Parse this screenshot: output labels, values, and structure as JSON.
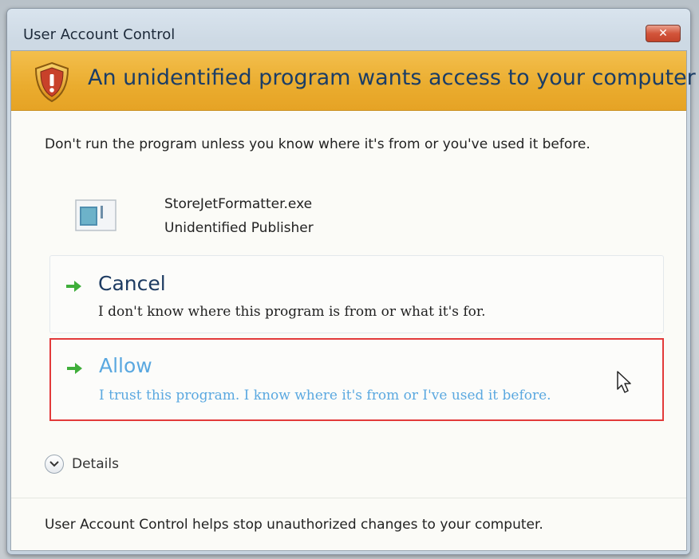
{
  "window": {
    "title": "User Account Control",
    "close_icon": "close-icon"
  },
  "banner": {
    "icon": "shield-warning-icon",
    "heading": "An unidentified program wants access to your computer",
    "color": "#eaac2e"
  },
  "warning": {
    "text": "Don't run the program unless you know where it's from or you've used it before."
  },
  "program": {
    "icon": "program-icon",
    "name": "StoreJetFormatter.exe",
    "publisher": "Unidentified Publisher"
  },
  "options": [
    {
      "title": "Cancel",
      "description": "I don't know where this program is from or what it's for.",
      "icon": "green-arrow-icon",
      "highlighted": false
    },
    {
      "title": "Allow",
      "description": "I trust this program. I know where it's from or I've used it before.",
      "icon": "green-arrow-icon",
      "highlighted": true,
      "highlight_color": "#e23a3a"
    }
  ],
  "details": {
    "label": "Details",
    "icon": "chevron-down-icon"
  },
  "footer": {
    "text": "User Account Control helps stop unauthorized changes to your computer."
  },
  "colors": {
    "accent_link": "#5aa8e0",
    "arrow_green": "#3fae3a"
  }
}
